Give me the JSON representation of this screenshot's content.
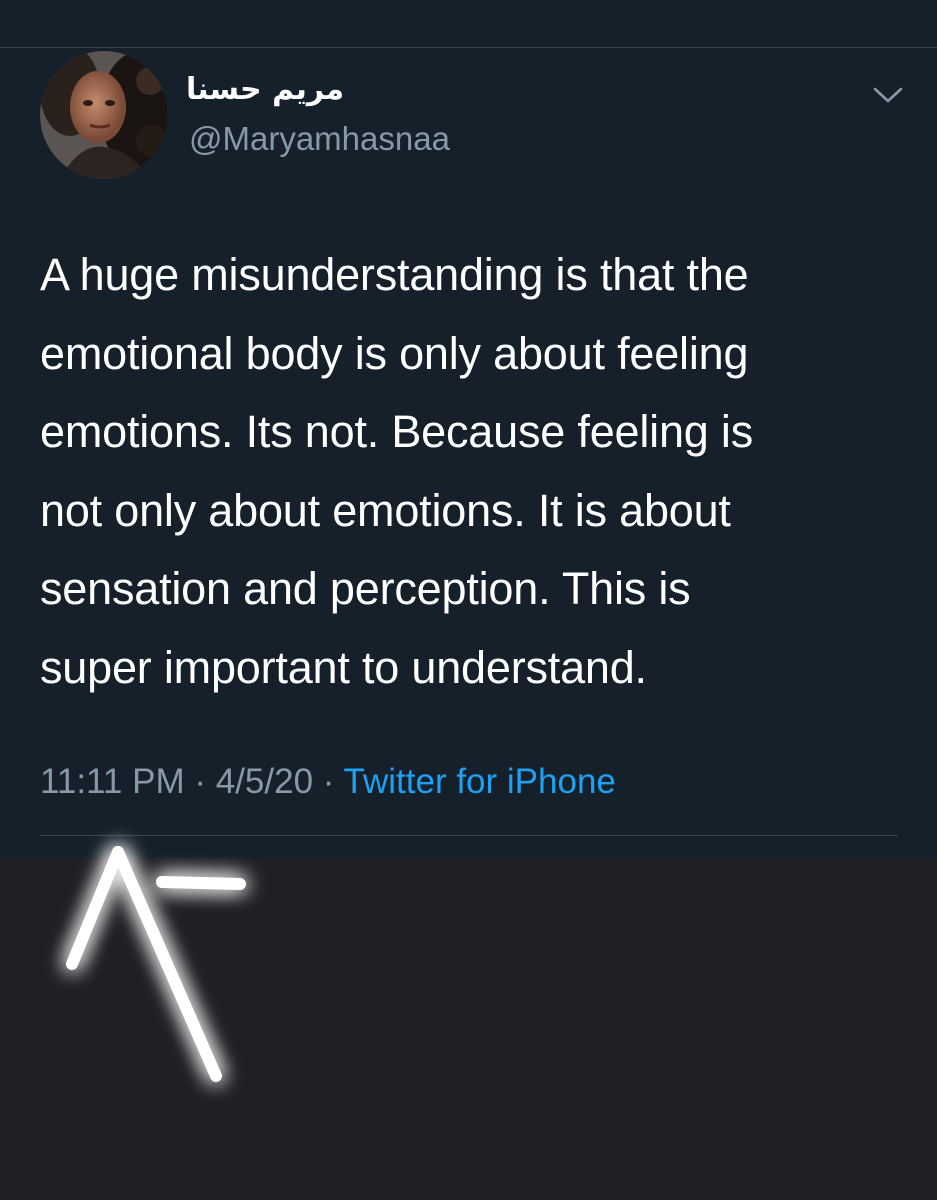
{
  "tweet": {
    "display_name": "مريم حسنا",
    "handle": "@Maryamhasnaa",
    "text": "A huge misunderstanding is that the\nemotional body is only about feeling\nemotions.  Its not. Because feeling is\nnot only about emotions. It is about\nsensation and perception. This is\nsuper important to understand.",
    "time": "11:11 PM",
    "date": "4/5/20",
    "source": "Twitter for iPhone",
    "separator": " · "
  },
  "icons": {
    "menu": "chevron-down-icon",
    "annotation": "hand-drawn-arrow-icon"
  },
  "colors": {
    "background": "#15202b",
    "lower_background": "#1f2024",
    "text_primary": "#ffffff",
    "text_secondary": "#8899a6",
    "link": "#1da1f2",
    "divider": "#38444d"
  }
}
